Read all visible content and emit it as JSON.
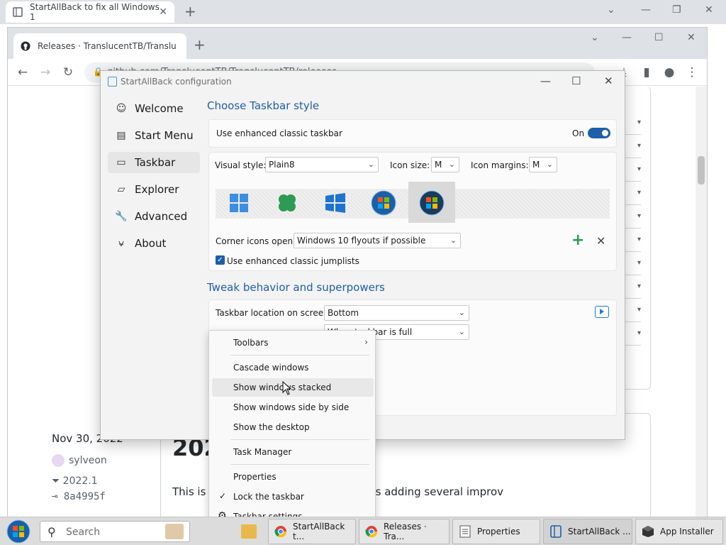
{
  "browser1": {
    "tab_title": "StartAllBack to fix all Windows 1",
    "new_tab": "+",
    "controls": {
      "minimize": "—",
      "restore": "❐",
      "close": "✕",
      "dropdown": "⌄"
    }
  },
  "browser2": {
    "tab_title": "Releases · TranslucentTB/Translu",
    "new_tab": "+",
    "url": "github.com/TranslucentTB/TranslucentTB/releases",
    "controls": {
      "minimize": "—",
      "restore": "☐",
      "close": "✕",
      "dropdown": "⌄"
    },
    "page": {
      "date": "Nov 30, 2022",
      "author": "sylveon",
      "tag": "2022.1",
      "commit": "8a4995f",
      "title": "202",
      "paragraph": "This is a                                            ndows Sun Valley 2, as well as adding several improv"
    }
  },
  "sab": {
    "title": "StartAllBack configuration",
    "nav": [
      {
        "label": "Welcome",
        "icon": "smile-icon"
      },
      {
        "label": "Start Menu",
        "icon": "start-menu-icon"
      },
      {
        "label": "Taskbar",
        "icon": "taskbar-icon"
      },
      {
        "label": "Explorer",
        "icon": "folder-icon"
      },
      {
        "label": "Advanced",
        "icon": "wrench-icon"
      },
      {
        "label": "About",
        "icon": "about-icon"
      }
    ],
    "section1_title": "Choose Taskbar style",
    "enhanced_label": "Use enhanced classic taskbar",
    "toggle_label": "On",
    "visual_style_label": "Visual style:",
    "visual_style_value": "Plain8",
    "icon_size_label": "Icon size:",
    "icon_size_value": "M",
    "icon_margins_label": "Icon margins:",
    "icon_margins_value": "M",
    "corner_icons_label": "Corner icons open:",
    "corner_icons_value": "Windows 10 flyouts if possible",
    "jumplists_label": "Use enhanced classic jumplists",
    "section2_title": "Tweak behavior and superpowers",
    "location_label": "Taskbar location on screen:",
    "location_value": "Bottom",
    "combine_value": "When taskbar is full",
    "add_symbol": "+",
    "remove_symbol": "✕"
  },
  "context_menu": {
    "toolbars": "Toolbars",
    "cascade": "Cascade windows",
    "stacked": "Show windows stacked",
    "side_by_side": "Show windows side by side",
    "desktop": "Show the desktop",
    "task_manager": "Task Manager",
    "properties": "Properties",
    "lock": "Lock the taskbar",
    "settings": "Taskbar settings"
  },
  "taskbar": {
    "search_placeholder": "Search",
    "buttons": [
      "StartAllBack t...",
      "Releases · Tra...",
      "Properties",
      "StartAllBack ...",
      "App Installer"
    ]
  }
}
